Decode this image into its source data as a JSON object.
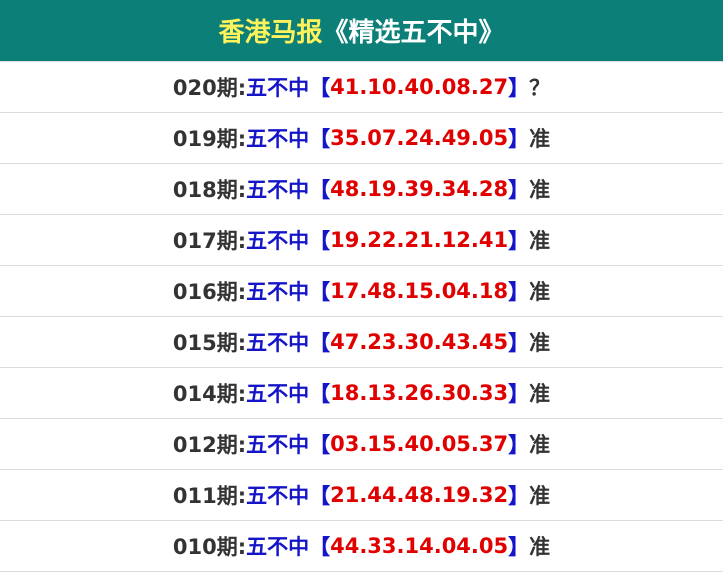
{
  "header": {
    "title_main": "香港马报",
    "title_sub": "《精选五不中》"
  },
  "label": "五不中",
  "bracket_open": "【",
  "bracket_close": "】",
  "rows": [
    {
      "period": "020期:",
      "numbers": "41.10.40.08.27",
      "status": "？"
    },
    {
      "period": "019期:",
      "numbers": "35.07.24.49.05",
      "status": "准"
    },
    {
      "period": "018期:",
      "numbers": "48.19.39.34.28",
      "status": "准"
    },
    {
      "period": "017期:",
      "numbers": "19.22.21.12.41",
      "status": "准"
    },
    {
      "period": "016期:",
      "numbers": "17.48.15.04.18",
      "status": "准"
    },
    {
      "period": "015期:",
      "numbers": "47.23.30.43.45",
      "status": "准"
    },
    {
      "period": "014期:",
      "numbers": "18.13.26.30.33",
      "status": "准"
    },
    {
      "period": "012期:",
      "numbers": "03.15.40.05.37",
      "status": "准"
    },
    {
      "period": "011期:",
      "numbers": "21.44.48.19.32",
      "status": "准"
    },
    {
      "period": "010期:",
      "numbers": "44.33.14.04.05",
      "status": "准"
    }
  ]
}
